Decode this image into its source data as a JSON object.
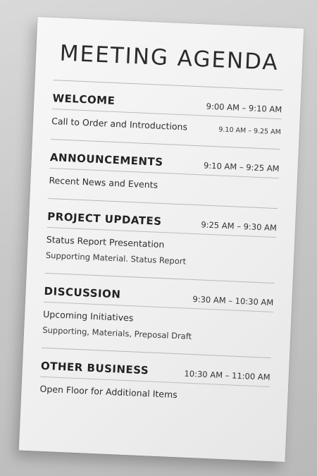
{
  "title": "MEETING AGENDA",
  "sections": [
    {
      "heading": "WELCOME",
      "time": "9:00 AM – 9:10 AM",
      "item": "Call to Order and Introductions",
      "item_time": "9.10 AM – 9.25 AM"
    },
    {
      "heading": "ANNOUNCEMENTS",
      "time": "9:10 AM – 9:25 AM",
      "item": "Recent News and Events"
    },
    {
      "heading": "PROJECT UPDATES",
      "time": "9:25 AM – 9:30 AM",
      "item": "Status Report Presentation",
      "sub": "Supporting Material. Status Report"
    },
    {
      "heading": "DISCUSSION",
      "time": "9:30 AM – 10:30 AM",
      "item": "Upcoming Initiatives",
      "sub": "Supporting, Materials, Preposal Draft"
    },
    {
      "heading": "OTHER BUSINESS",
      "time": "10:30 AM – 11:00 AM",
      "item": "Open Floor for Additional Items"
    }
  ]
}
